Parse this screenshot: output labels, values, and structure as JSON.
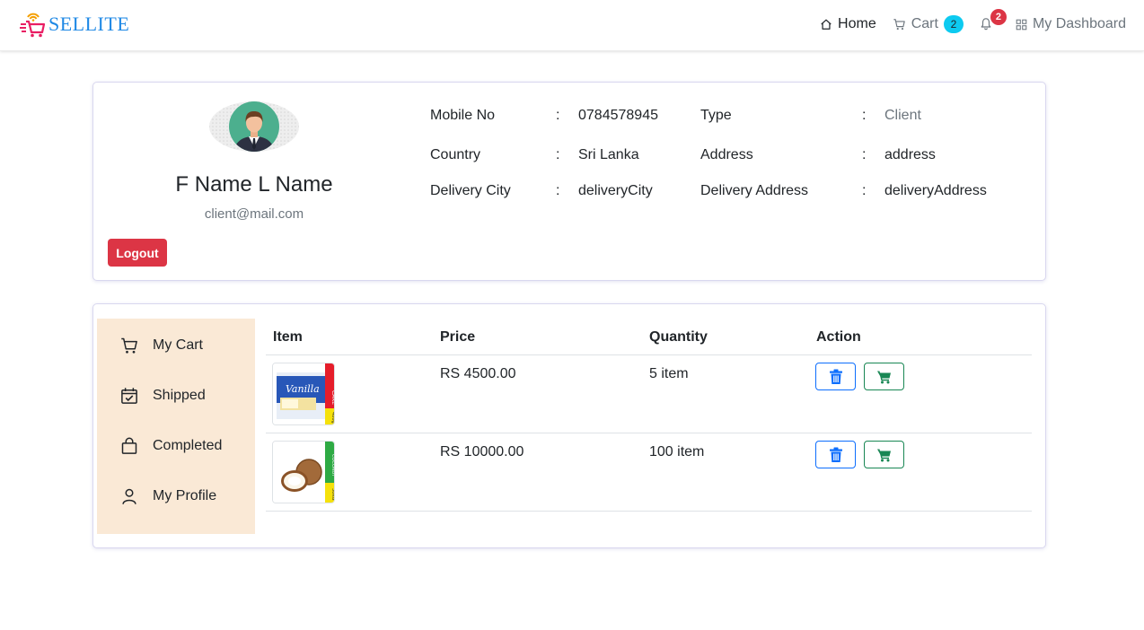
{
  "brand": {
    "name": "SELLITE"
  },
  "nav": {
    "home": "Home",
    "cart": "Cart",
    "cart_count": "2",
    "notif_count": "2",
    "dashboard": "My Dashboard"
  },
  "profile": {
    "full_name": "F Name L Name",
    "email": "client@mail.com",
    "logout_label": "Logout",
    "fields": {
      "mobile_label": "Mobile No",
      "mobile_value": "0784578945",
      "type_label": "Type",
      "type_value": "Client",
      "country_label": "Country",
      "country_value": "Sri Lanka",
      "address_label": "Address",
      "address_value": "address",
      "city_label": "Delivery City",
      "city_value": "deliveryCity",
      "daddress_label": "Delivery Address",
      "daddress_value": "deliveryAddress",
      "sep": ":"
    }
  },
  "sidebar": {
    "items": [
      {
        "label": "My Cart",
        "icon": "cart-icon"
      },
      {
        "label": "Shipped",
        "icon": "calendar-check-icon"
      },
      {
        "label": "Completed",
        "icon": "bag-icon"
      },
      {
        "label": "My Profile",
        "icon": "person-icon"
      }
    ]
  },
  "table": {
    "headers": {
      "item": "Item",
      "price": "Price",
      "quantity": "Quantity",
      "action": "Action"
    },
    "rows": [
      {
        "price": "RS 4500.00",
        "quantity": "5 item",
        "image": "vanilla-cake-package"
      },
      {
        "price": "RS 10000.00",
        "quantity": "100 item",
        "image": "coconut-package"
      }
    ]
  },
  "colors": {
    "brand": "#1e88e5",
    "danger": "#dc3545",
    "primary": "#0d6efd",
    "success": "#198754",
    "info": "#0dcaf0",
    "sidebar_bg": "#fae9d6"
  }
}
